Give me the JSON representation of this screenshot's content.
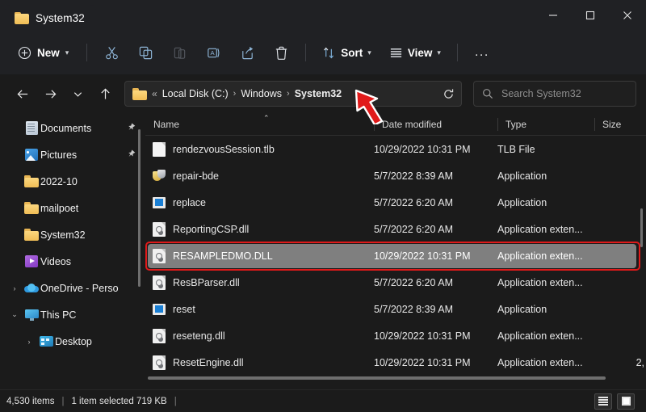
{
  "window": {
    "tab_title": "System32",
    "tab_icon": "folder-icon",
    "minimize_label": "Minimize",
    "maximize_label": "Maximize",
    "close_label": "Close"
  },
  "toolbar": {
    "new_label": "New",
    "new_icon": "plus-circle-icon",
    "cut_icon": "scissors-icon",
    "copy_icon": "copy-icon",
    "paste_icon": "paste-icon",
    "rename_icon": "rename-icon",
    "share_icon": "share-icon",
    "delete_icon": "trash-icon",
    "sort_label": "Sort",
    "sort_icon": "sort-arrows-icon",
    "view_label": "View",
    "view_icon": "lines-icon",
    "more_label": "..."
  },
  "address": {
    "back_icon": "arrow-left-icon",
    "forward_icon": "arrow-right-icon",
    "recent_icon": "chevron-down-icon",
    "up_icon": "arrow-up-icon",
    "folder_icon": "folder-icon",
    "overflow": "«",
    "crumbs": [
      {
        "label": "Local Disk (C:)",
        "current": false
      },
      {
        "label": "Windows",
        "current": false
      },
      {
        "label": "System32",
        "current": true
      }
    ],
    "separator": "›",
    "refresh_icon": "refresh-icon",
    "search_icon": "search-icon",
    "search_placeholder": "Search System32",
    "search_value": ""
  },
  "sidebar": {
    "items": [
      {
        "label": "Documents",
        "icon": "documents-icon",
        "pinned": true,
        "expander": "",
        "indent": 0
      },
      {
        "label": "Pictures",
        "icon": "pictures-icon",
        "pinned": true,
        "expander": "",
        "indent": 0
      },
      {
        "label": "2022-10",
        "icon": "folder-icon",
        "pinned": false,
        "expander": "",
        "indent": 0
      },
      {
        "label": "mailpoet",
        "icon": "folder-icon",
        "pinned": false,
        "expander": "",
        "indent": 0
      },
      {
        "label": "System32",
        "icon": "folder-icon",
        "pinned": false,
        "expander": "",
        "indent": 0
      },
      {
        "label": "Videos",
        "icon": "videos-icon",
        "pinned": false,
        "expander": "",
        "indent": 0
      },
      {
        "label": "OneDrive - Perso",
        "icon": "onedrive-cloud-icon",
        "pinned": false,
        "expander": "›",
        "indent": 0
      },
      {
        "label": "This PC",
        "icon": "this-pc-icon",
        "pinned": false,
        "expander": "⌄",
        "indent": 0
      },
      {
        "label": "Desktop",
        "icon": "desktop-icon",
        "pinned": false,
        "expander": "›",
        "indent": 1
      }
    ],
    "pin_glyph": "📌"
  },
  "filelist": {
    "columns": [
      {
        "key": "name",
        "label": "Name",
        "sorted": "asc",
        "sort_glyph": "⌃"
      },
      {
        "key": "date",
        "label": "Date modified"
      },
      {
        "key": "type",
        "label": "Type"
      },
      {
        "key": "size",
        "label": "Size"
      }
    ],
    "rows": [
      {
        "name": "rendezvousSession.tlb",
        "date": "10/29/2022 10:31 PM",
        "type": "TLB File",
        "size": "",
        "icon": "blank-file-icon",
        "selected": false
      },
      {
        "name": "repair-bde",
        "date": "5/7/2022 8:39 AM",
        "type": "Application",
        "size": "",
        "icon": "shield-app-icon",
        "selected": false
      },
      {
        "name": "replace",
        "date": "5/7/2022 6:20 AM",
        "type": "Application",
        "size": "",
        "icon": "app-icon",
        "selected": false
      },
      {
        "name": "ReportingCSP.dll",
        "date": "5/7/2022 6:20 AM",
        "type": "Application exten...",
        "size": "",
        "icon": "dll-icon",
        "selected": false
      },
      {
        "name": "RESAMPLEDMO.DLL",
        "date": "10/29/2022 10:31 PM",
        "type": "Application exten...",
        "size": "",
        "icon": "dll-icon",
        "selected": true
      },
      {
        "name": "ResBParser.dll",
        "date": "5/7/2022 6:20 AM",
        "type": "Application exten...",
        "size": "",
        "icon": "dll-icon",
        "selected": false
      },
      {
        "name": "reset",
        "date": "5/7/2022 8:39 AM",
        "type": "Application",
        "size": "",
        "icon": "app-icon",
        "selected": false
      },
      {
        "name": "reseteng.dll",
        "date": "10/29/2022 10:31 PM",
        "type": "Application exten...",
        "size": "",
        "icon": "dll-icon",
        "selected": false
      },
      {
        "name": "ResetEngine.dll",
        "date": "10/29/2022 10:31 PM",
        "type": "Application exten...",
        "size": "2,",
        "icon": "dll-icon",
        "selected": false
      }
    ]
  },
  "statusbar": {
    "item_count": "4,530 items",
    "separator": "|",
    "selection": "1 item selected  719 KB",
    "trailing_separator": "|",
    "details_view_label": "Details view",
    "icons_view_label": "Large icons view"
  },
  "annotation": {
    "arrow_color": "#e01a1a",
    "arrow_target": "System32 breadcrumb",
    "highlight_color": "#e01a1a",
    "highlight_target": "RESAMPLEDMO.DLL"
  }
}
